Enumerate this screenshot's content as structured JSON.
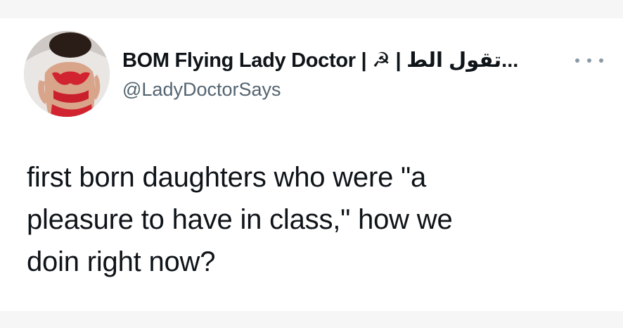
{
  "tweet": {
    "author": {
      "display_name": "BOM Flying Lady Doctor | ☭ | تقول الط...",
      "handle": "@LadyDoctorSays",
      "avatar_icon": "profile-photo-avatar"
    },
    "more_icon": "more-options-icon",
    "text_lines": [
      "first born daughters who were \"a",
      "pleasure to have in class,\" how we",
      "doin right now?"
    ]
  },
  "colors": {
    "text": "#0f1419",
    "secondary_text": "#536471",
    "dots": "#8b98a5",
    "background": "#ffffff"
  }
}
